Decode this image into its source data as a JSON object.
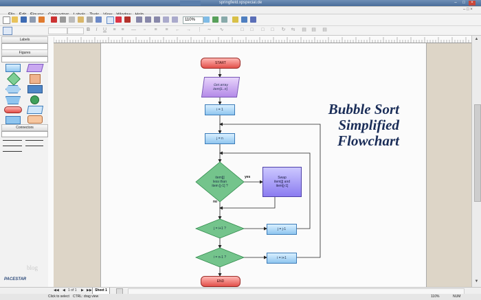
{
  "window": {
    "title": "springfield.xpspecial.de"
  },
  "menu": [
    "File",
    "Edit",
    "Figures",
    "Connectors",
    "Labels",
    "Tools",
    "View",
    "Window",
    "Help"
  ],
  "toolbar": {
    "zoom": "110%"
  },
  "sidebar": {
    "labels_header": "Labels",
    "figures_header": "Figures",
    "connectors_header": "Connectors"
  },
  "flowchart": {
    "title_lines": [
      "Bubble Sort",
      "Simplified",
      "Flowchart"
    ],
    "start": "START",
    "get_array": [
      "Get array",
      "item[1..n]"
    ],
    "init_i": "i = 1",
    "init_j": "j = n",
    "compare": [
      "item[j]",
      "less than",
      "item [j-1] ?"
    ],
    "yes": "yes",
    "no": "no",
    "swap": [
      "Swap",
      "item[j] and",
      "item[j-1]"
    ],
    "check_j": "j = i+1 ?",
    "dec_j": "j = j-1",
    "check_i": "i = n-1 ?",
    "inc_i": "i = i+1",
    "end": "END"
  },
  "tabs": {
    "page": "1 of 1",
    "sheet": "Sheet 1"
  },
  "status": {
    "hint1": "Click to select",
    "hint2": "CTRL: drag view",
    "zoom": "110%",
    "num": "NUM"
  },
  "branding": {
    "logo": "PACESTAR",
    "watermark": "blog"
  }
}
